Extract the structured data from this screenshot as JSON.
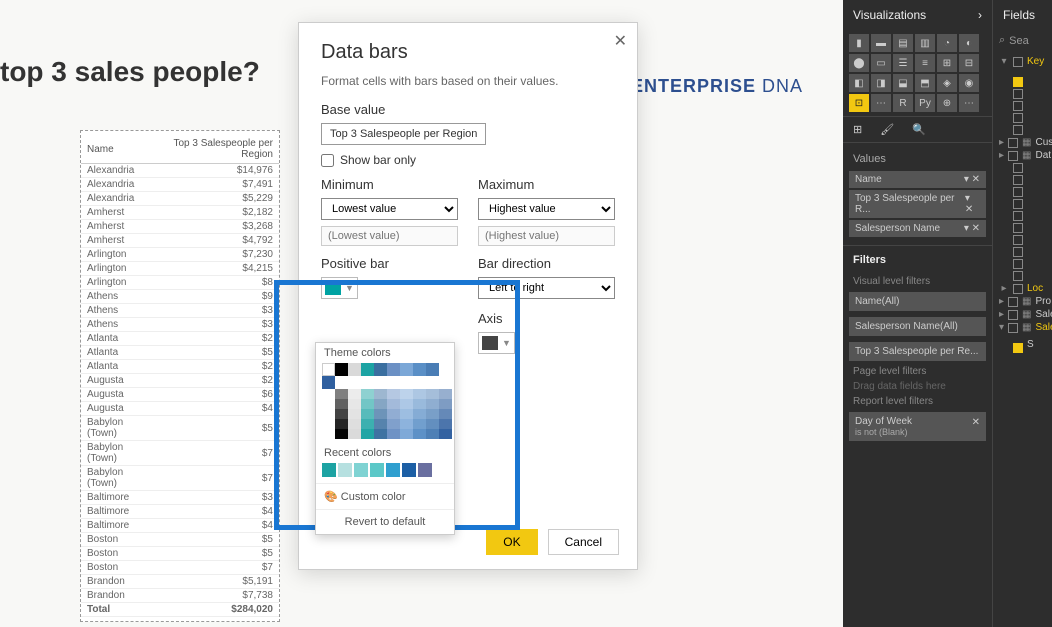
{
  "report": {
    "title": "top 3 sales people?"
  },
  "logo": {
    "brand": "ENTERPRISE",
    "suffix": "DNA"
  },
  "table": {
    "header_name": "Name",
    "header_measure": "Top 3 Salespeople per Region",
    "rows": [
      {
        "name": "Alexandria",
        "val": "$14,976"
      },
      {
        "name": "Alexandria",
        "val": "$7,491"
      },
      {
        "name": "Alexandria",
        "val": "$5,229"
      },
      {
        "name": "Amherst",
        "val": "$2,182"
      },
      {
        "name": "Amherst",
        "val": "$3,268"
      },
      {
        "name": "Amherst",
        "val": "$4,792"
      },
      {
        "name": "Arlington",
        "val": "$7,230"
      },
      {
        "name": "Arlington",
        "val": "$4,215"
      },
      {
        "name": "Arlington",
        "val": "$8"
      },
      {
        "name": "Athens",
        "val": "$9"
      },
      {
        "name": "Athens",
        "val": "$3"
      },
      {
        "name": "Athens",
        "val": "$3"
      },
      {
        "name": "Atlanta",
        "val": "$2"
      },
      {
        "name": "Atlanta",
        "val": "$5"
      },
      {
        "name": "Atlanta",
        "val": "$2"
      },
      {
        "name": "Augusta",
        "val": "$2"
      },
      {
        "name": "Augusta",
        "val": "$6"
      },
      {
        "name": "Augusta",
        "val": "$4"
      },
      {
        "name": "Babylon (Town)",
        "val": "$5"
      },
      {
        "name": "Babylon (Town)",
        "val": "$7"
      },
      {
        "name": "Babylon (Town)",
        "val": "$7"
      },
      {
        "name": "Baltimore",
        "val": "$3"
      },
      {
        "name": "Baltimore",
        "val": "$4"
      },
      {
        "name": "Baltimore",
        "val": "$4"
      },
      {
        "name": "Boston",
        "val": "$5"
      },
      {
        "name": "Boston",
        "val": "$5"
      },
      {
        "name": "Boston",
        "val": "$7"
      },
      {
        "name": "Brandon",
        "val": "$5,191"
      },
      {
        "name": "Brandon",
        "val": "$7,738"
      }
    ],
    "total_label": "Total",
    "total_value": "$284,020"
  },
  "dialog": {
    "title": "Data bars",
    "desc": "Format cells with bars based on their values.",
    "base_label": "Base value",
    "base_value": "Top 3 Salespeople per Region",
    "show_bar_only": "Show bar only",
    "min_label": "Minimum",
    "max_label": "Maximum",
    "min_select": "Lowest value",
    "max_select": "Highest value",
    "min_placeholder": "(Lowest value)",
    "max_placeholder": "(Highest value)",
    "pos_label": "Positive bar",
    "direction_label": "Bar direction",
    "direction_value": "Left to right",
    "axis_label": "Axis",
    "ok": "OK",
    "cancel": "Cancel",
    "pos_color": "#00a3a3",
    "axis_color": "#444444"
  },
  "picker": {
    "theme_label": "Theme colors",
    "recent_label": "Recent colors",
    "custom_label": "Custom color",
    "revert_label": "Revert to default",
    "theme_top": [
      "#ffffff",
      "#000000",
      "#d9d9d9",
      "#1ca3a3",
      "#3a6fa0",
      "#6b90c4",
      "#7ba7d7",
      "#5a8fc6",
      "#4a7db5",
      "#2f5f9f"
    ],
    "recent": [
      "#1ca3a3",
      "#b6e0e0",
      "#7fd3d3",
      "#5bc8c8",
      "#2f9fcf",
      "#1d5fa5",
      "#6a6fa0"
    ]
  },
  "vis_panel": {
    "title": "Visualizations",
    "values_label": "Values",
    "value_pills": [
      "Name",
      "Top 3 Salespeople per R...",
      "Salesperson Name"
    ],
    "filters_label": "Filters",
    "vlf": "Visual level filters",
    "f1": "Name(All)",
    "f2": "Salesperson Name(All)",
    "f3": "Top 3 Salespeople per Re...",
    "plf": "Page level filters",
    "drag": "Drag data fields here",
    "rlf": "Report level filters",
    "dow": "Day of Week",
    "dow_sub": "is not (Blank)"
  },
  "fields_panel": {
    "title": "Fields",
    "search_placeholder": "Sea",
    "items": [
      {
        "caret": "▾",
        "check": false,
        "yellow": true,
        "label": "Key"
      },
      {
        "caret": "",
        "check": true,
        "yellow": false,
        "label": ""
      },
      {
        "caret": "",
        "check": false,
        "yellow": false,
        "label": ""
      },
      {
        "caret": "",
        "check": false,
        "yellow": false,
        "label": ""
      },
      {
        "caret": "",
        "check": false,
        "yellow": false,
        "label": ""
      },
      {
        "caret": "",
        "check": false,
        "yellow": false,
        "label": ""
      },
      {
        "caret": "▸",
        "check": false,
        "yellow": false,
        "label": "Cus",
        "table": true
      },
      {
        "caret": "▸",
        "check": false,
        "yellow": false,
        "label": "Dat",
        "table": true
      },
      {
        "caret": "",
        "check": false,
        "yellow": false,
        "label": ""
      },
      {
        "caret": "",
        "check": false,
        "yellow": false,
        "label": ""
      },
      {
        "caret": "",
        "check": false,
        "yellow": false,
        "label": ""
      },
      {
        "caret": "",
        "check": false,
        "yellow": false,
        "label": ""
      },
      {
        "caret": "",
        "check": false,
        "yellow": false,
        "label": ""
      },
      {
        "caret": "",
        "check": false,
        "yellow": false,
        "label": ""
      },
      {
        "caret": "",
        "check": false,
        "yellow": false,
        "label": ""
      },
      {
        "caret": "",
        "check": false,
        "yellow": false,
        "label": ""
      },
      {
        "caret": "",
        "check": false,
        "yellow": false,
        "label": ""
      },
      {
        "caret": "",
        "check": false,
        "yellow": false,
        "label": ""
      },
      {
        "caret": "▸",
        "check": false,
        "yellow": true,
        "label": "Loc"
      },
      {
        "caret": "▸",
        "check": false,
        "yellow": false,
        "label": "Pro",
        "table": true
      },
      {
        "caret": "▸",
        "check": false,
        "yellow": false,
        "label": "Sale",
        "table": true
      },
      {
        "caret": "▾",
        "check": false,
        "yellow": true,
        "label": "Sale",
        "table": true
      },
      {
        "caret": "",
        "check": true,
        "yellow": false,
        "label": "S"
      }
    ]
  }
}
